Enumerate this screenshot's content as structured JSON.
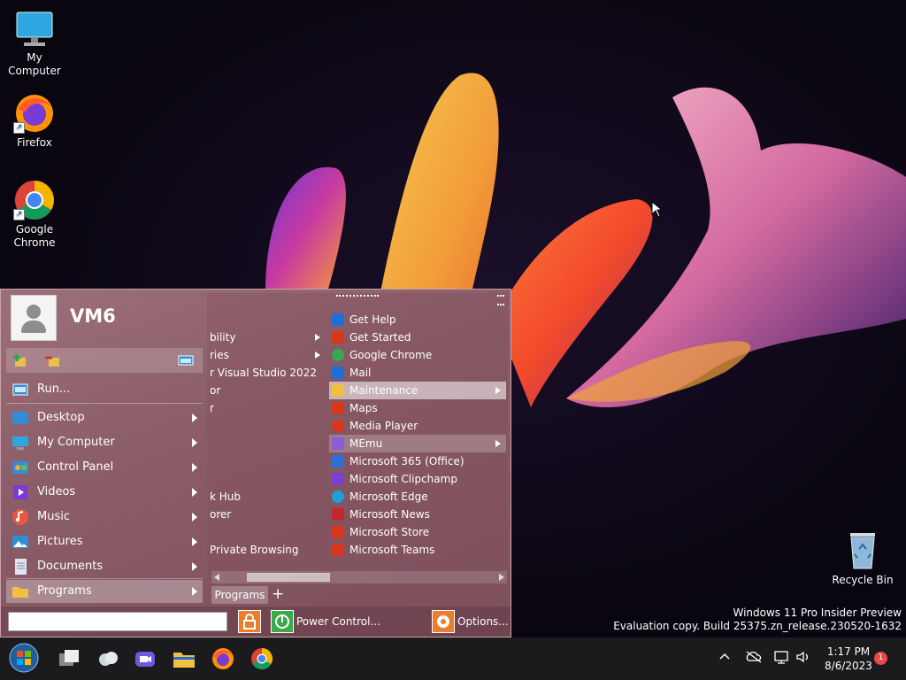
{
  "desktop": {
    "icons": [
      {
        "label": "My Computer",
        "icon": "monitor-icon"
      },
      {
        "label": "Firefox",
        "icon": "firefox-icon"
      },
      {
        "label": "Google Chrome",
        "icon": "chrome-icon"
      },
      {
        "label": "Recycle Bin",
        "icon": "recycle-bin-icon"
      }
    ],
    "watermark": {
      "line1": "Windows 11 Pro Insider Preview",
      "line2": "Evaluation copy. Build 25375.zn_release.230520-1632"
    }
  },
  "start_menu": {
    "user_name": "VM6",
    "left_items": [
      {
        "label": "Run...",
        "icon": "run-icon",
        "submenu": false
      },
      {
        "label": "Desktop",
        "icon": "desktop-icon",
        "submenu": true
      },
      {
        "label": "My Computer",
        "icon": "monitor-icon",
        "submenu": true
      },
      {
        "label": "Control Panel",
        "icon": "control-panel-icon",
        "submenu": true
      },
      {
        "label": "Videos",
        "icon": "videos-icon",
        "submenu": true
      },
      {
        "label": "Music",
        "icon": "music-icon",
        "submenu": true
      },
      {
        "label": "Pictures",
        "icon": "pictures-icon",
        "submenu": true
      },
      {
        "label": "Documents",
        "icon": "documents-icon",
        "submenu": true
      },
      {
        "label": "Programs",
        "icon": "folder-icon",
        "submenu": true
      }
    ],
    "programs_col1": [
      {
        "label": "bility",
        "submenu": true
      },
      {
        "label": "ries",
        "submenu": true
      },
      {
        "label": "r Visual Studio 2022",
        "submenu": false
      },
      {
        "label": "or",
        "submenu": false
      },
      {
        "label": "r",
        "submenu": false
      },
      {
        "label": "k Hub",
        "submenu": false
      },
      {
        "label": "orer",
        "submenu": false
      },
      {
        "label": "Private Browsing",
        "submenu": false
      }
    ],
    "programs_col2": [
      {
        "label": "Get Help",
        "color": "#1e6fd9"
      },
      {
        "label": "Get Started",
        "color": "#d9361e"
      },
      {
        "label": "Google Chrome",
        "color": "#34a853"
      },
      {
        "label": "Mail",
        "color": "#1e6fd9"
      },
      {
        "label": "Maintenance",
        "color": "#f0c040",
        "submenu": true,
        "highlight": "strong"
      },
      {
        "label": "Maps",
        "color": "#d9361e"
      },
      {
        "label": "Media Player",
        "color": "#d9361e"
      },
      {
        "label": "MEmu",
        "color": "#8a5cd6",
        "submenu": true,
        "highlight": "soft"
      },
      {
        "label": "Microsoft 365 (Office)",
        "color": "#2b6fd9"
      },
      {
        "label": "Microsoft Clipchamp",
        "color": "#7a3fd0"
      },
      {
        "label": "Microsoft Edge",
        "color": "#1ea0d9"
      },
      {
        "label": "Microsoft News",
        "color": "#c0282e"
      },
      {
        "label": "Microsoft Store",
        "color": "#d9361e"
      },
      {
        "label": "Microsoft Teams",
        "color": "#d9361e"
      }
    ],
    "programs_tab": "Programs",
    "search_placeholder": "",
    "power_label": "Power Control...",
    "options_label": "Options..."
  },
  "taskbar": {
    "apps": [
      "start-orb-icon",
      "task-view-icon",
      "weather-icon",
      "meet-icon",
      "file-explorer-icon",
      "firefox-icon",
      "chrome-icon"
    ],
    "time": "1:17 PM",
    "date": "8/6/2023",
    "notification_count": "1"
  }
}
